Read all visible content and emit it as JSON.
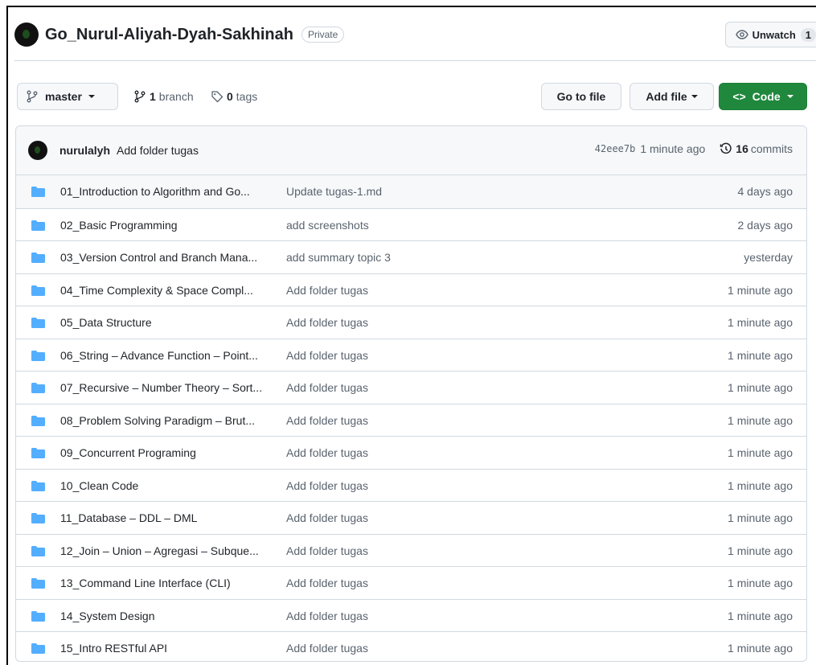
{
  "repo": {
    "name": "Go_Nurul-Aliyah-Dyah-Sakhinah",
    "visibility": "Private"
  },
  "watch": {
    "label": "Unwatch",
    "count": "1"
  },
  "toolbar": {
    "branch_label": "master",
    "branch_count": "1",
    "branch_word": "branch",
    "tag_count": "0",
    "tag_word": "tags",
    "goto_label": "Go to file",
    "addfile_label": "Add file",
    "code_label": "Code"
  },
  "latest_commit": {
    "user": "nurulalyh",
    "message": "Add folder tugas",
    "sha": "42eee7b",
    "time": "1 minute ago",
    "commit_count": "16",
    "commit_word": "commits"
  },
  "files": [
    {
      "name": "01_Introduction to Algorithm and Go...",
      "message": "Update tugas-1.md",
      "date": "4 days ago"
    },
    {
      "name": "02_Basic Programming",
      "message": "add screenshots",
      "date": "2 days ago"
    },
    {
      "name": "03_Version Control and Branch Mana...",
      "message": "add summary topic 3",
      "date": "yesterday"
    },
    {
      "name": "04_Time Complexity & Space Compl...",
      "message": "Add folder tugas",
      "date": "1 minute ago"
    },
    {
      "name": "05_Data Structure",
      "message": "Add folder tugas",
      "date": "1 minute ago"
    },
    {
      "name": "06_String – Advance Function – Point...",
      "message": "Add folder tugas",
      "date": "1 minute ago"
    },
    {
      "name": "07_Recursive – Number Theory – Sort...",
      "message": "Add folder tugas",
      "date": "1 minute ago"
    },
    {
      "name": "08_Problem Solving Paradigm – Brut...",
      "message": "Add folder tugas",
      "date": "1 minute ago"
    },
    {
      "name": "09_Concurrent Programing",
      "message": "Add folder tugas",
      "date": "1 minute ago"
    },
    {
      "name": "10_Clean Code",
      "message": "Add folder tugas",
      "date": "1 minute ago"
    },
    {
      "name": "11_Database – DDL – DML",
      "message": "Add folder tugas",
      "date": "1 minute ago"
    },
    {
      "name": "12_Join – Union – Agregasi – Subque...",
      "message": "Add folder tugas",
      "date": "1 minute ago"
    },
    {
      "name": "13_Command Line Interface (CLI)",
      "message": "Add folder tugas",
      "date": "1 minute ago"
    },
    {
      "name": "14_System Design",
      "message": "Add folder tugas",
      "date": "1 minute ago"
    },
    {
      "name": "15_Intro RESTful API",
      "message": "Add folder tugas",
      "date": "1 minute ago"
    }
  ],
  "colors": {
    "folder": "#54aeff",
    "primary": "#1f883d",
    "muted": "#59636e",
    "border": "#d1d9e0"
  }
}
